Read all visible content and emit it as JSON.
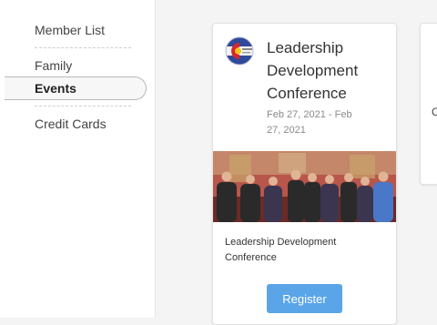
{
  "sidebar": {
    "items": [
      {
        "label": "Member List"
      },
      {
        "label": "Family"
      },
      {
        "label": "Events",
        "active": true
      },
      {
        "label": "Credit Cards"
      }
    ]
  },
  "event_card": {
    "title": "Leadership Development Conference",
    "date": "Feb 27, 2021 - Feb 27, 2021",
    "description": "Leadership Development Conference",
    "register_label": "Register",
    "logo_icon": "colorado-flag-logo-icon"
  },
  "partial_card": {
    "visible_text": "C"
  },
  "colors": {
    "button": "#5aa5e8",
    "active_nav_border": "#b9b9b9",
    "page_background": "#f4f4f4"
  }
}
